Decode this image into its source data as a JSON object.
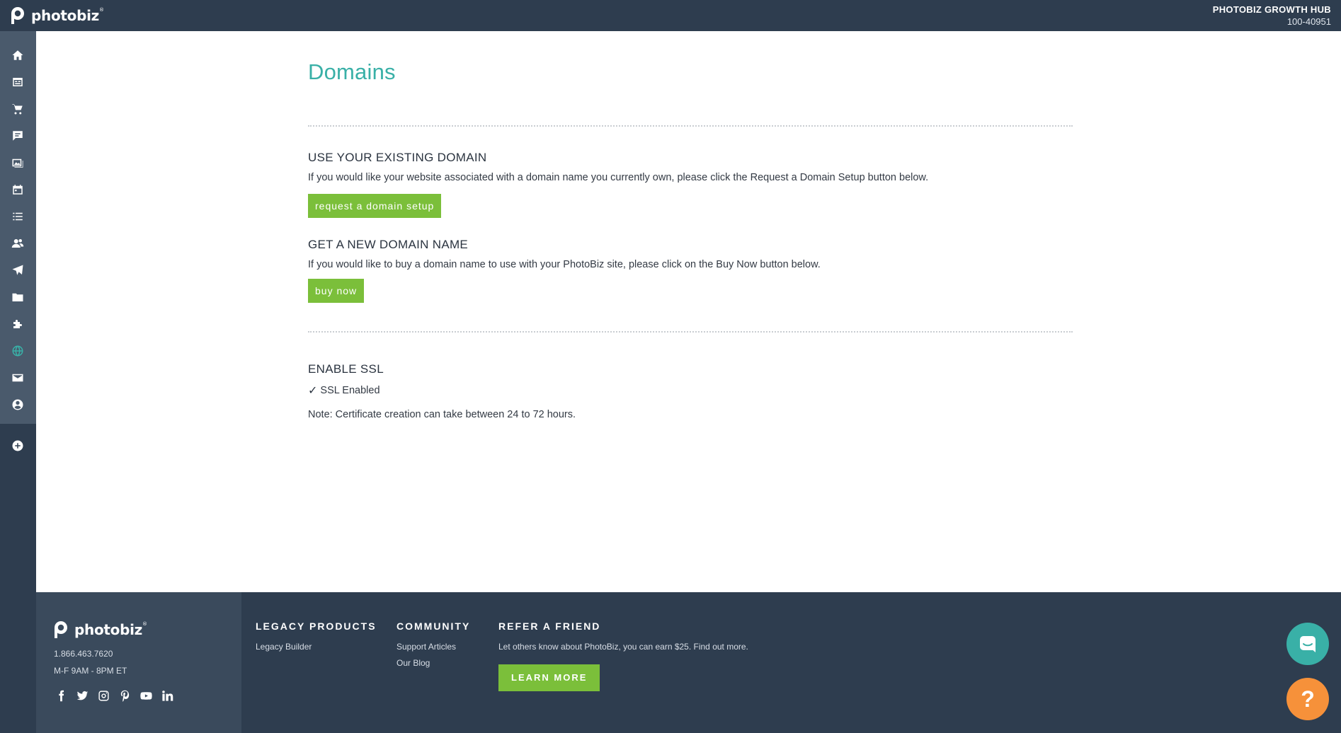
{
  "brand": {
    "name": "photobiz",
    "trademark": "®"
  },
  "account": {
    "name": "PHOTOBIZ GROWTH HUB",
    "id": "100-40951"
  },
  "sidebar": {
    "items": [
      {
        "icon": "home-icon"
      },
      {
        "icon": "pages-icon"
      },
      {
        "icon": "cart-icon"
      },
      {
        "icon": "comments-icon"
      },
      {
        "icon": "gallery-icon"
      },
      {
        "icon": "calendar-icon"
      },
      {
        "icon": "list-icon"
      },
      {
        "icon": "contacts-icon"
      },
      {
        "icon": "send-icon"
      },
      {
        "icon": "folder-icon"
      },
      {
        "icon": "puzzle-icon"
      },
      {
        "icon": "globe-icon",
        "active": true
      },
      {
        "icon": "mail-icon"
      },
      {
        "icon": "user-icon"
      },
      {
        "icon": "plus-circle-icon"
      }
    ],
    "active_color": "#39b0a7"
  },
  "main": {
    "title": "Domains",
    "existing_domain": {
      "heading": "USE YOUR EXISTING DOMAIN",
      "text": "If you would like your website associated with a domain name you currently own, please click the Request a Domain Setup button below.",
      "button": "request a domain setup"
    },
    "new_domain": {
      "heading": "GET A NEW DOMAIN NAME",
      "text": "If you would like to buy a domain name to use with your PhotoBiz site, please click on the Buy Now button below.",
      "button": "buy now"
    },
    "ssl": {
      "heading": "ENABLE SSL",
      "check": "✓",
      "status": "SSL Enabled",
      "note": "Note: Certificate creation can take between 24 to 72 hours."
    }
  },
  "footer": {
    "phone": "1.866.463.7620",
    "hours": "M-F 9AM - 8PM ET",
    "social": [
      "facebook-icon",
      "twitter-icon",
      "instagram-icon",
      "pinterest-icon",
      "youtube-icon",
      "linkedin-icon"
    ],
    "legacy": {
      "title": "LEGACY PRODUCTS",
      "links": [
        "Legacy Builder"
      ]
    },
    "community": {
      "title": "COMMUNITY",
      "links": [
        "Support Articles",
        "Our Blog"
      ]
    },
    "refer": {
      "title": "REFER A FRIEND",
      "text": "Let others know about PhotoBiz, you can earn $25. Find out more.",
      "button": "LEARN MORE"
    }
  },
  "floating": {
    "help_label": "?"
  },
  "colors": {
    "accent": "#39b0a7",
    "green": "#7bbf3a",
    "orange": "#f6913a",
    "navy": "#2e3d4f"
  }
}
